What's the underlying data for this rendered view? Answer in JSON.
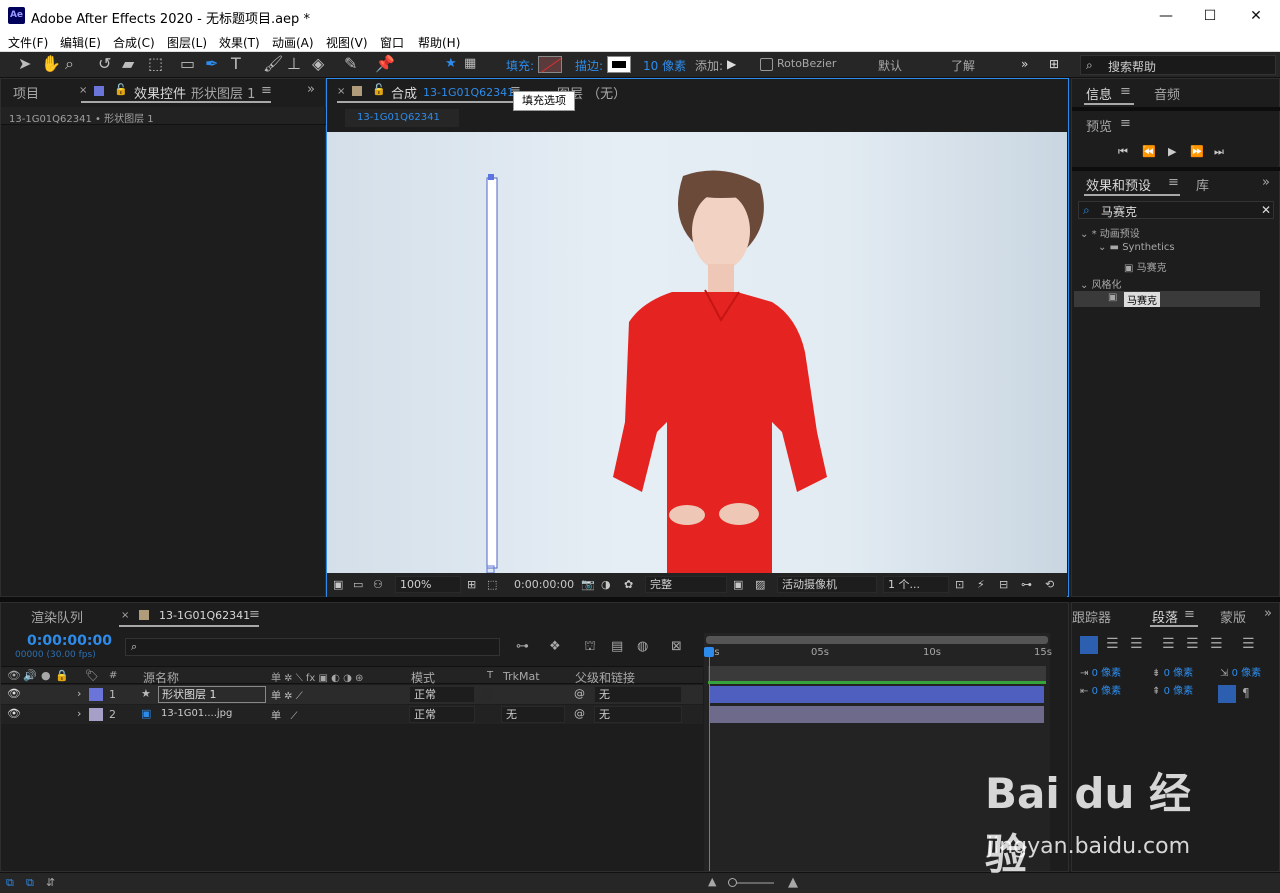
{
  "app": {
    "title": "Adobe After Effects 2020 - 无标题项目.aep *",
    "logo": "Ae"
  },
  "window_controls": {
    "minimize": "—",
    "maximize": "☐",
    "close": "✕"
  },
  "menu": [
    "文件(F)",
    "编辑(E)",
    "合成(C)",
    "图层(L)",
    "效果(T)",
    "动画(A)",
    "视图(V)",
    "窗口",
    "帮助(H)"
  ],
  "toolbar": {
    "fill_label": "填充:",
    "stroke_label": "描边:",
    "stroke_width": "10 像素",
    "add_label": "添加:",
    "roto_label": "RotoBezier",
    "default_label": "默认",
    "learn_label": "了解",
    "search_placeholder": "搜索帮助",
    "tooltip": "填充选项"
  },
  "left_panel": {
    "tab_project": "项目",
    "tab_effects_prefix": "效果控件",
    "tab_effects_layer": "形状图层 1",
    "breadcrumb": "13-1G01Q62341 • 形状图层 1"
  },
  "comp_panel": {
    "tab_label": "合成",
    "comp_name": "13-1G01Q62341",
    "layer_tab": "图层 （无）",
    "sub_tab": "13-1G01Q62341"
  },
  "viewer_bar": {
    "zoom": "100%",
    "timecode": "0:00:00:00",
    "quality": "完整",
    "camera": "活动摄像机",
    "views": "1 个..."
  },
  "right_panel": {
    "tab_info": "信息",
    "tab_audio": "音频",
    "tab_preview": "预览",
    "tab_effects": "效果和预设",
    "tab_library": "库",
    "search_value": "马赛克",
    "tree": [
      {
        "label": "* 动画预设",
        "level": 0
      },
      {
        "label": "Synthetics",
        "level": 1
      },
      {
        "label": "马赛克",
        "level": 2
      },
      {
        "label": "风格化",
        "level": 0
      },
      {
        "label": "马赛克",
        "level": 1,
        "selected": true
      }
    ],
    "tracker_tab": "跟踪器",
    "paragraph_tab": "段落",
    "mask_tab": "蒙版",
    "para_values": [
      "0 像素",
      "0 像素",
      "0 像素",
      "0 像素",
      "0 像素"
    ]
  },
  "timeline": {
    "render_tab": "渲染队列",
    "comp_tab": "13-1G01Q62341",
    "timecode": "0:00:00:00",
    "fps": "00000 (30.00 fps)",
    "search_placeholder": "",
    "columns": {
      "num": "#",
      "name": "源名称",
      "mode": "模式",
      "t": "T",
      "trkmat": "TrkMat",
      "parent": "父级和链接"
    },
    "layers": [
      {
        "num": "1",
        "name": "形状图层 1",
        "mode": "正常",
        "trkmat": "",
        "parent": "无",
        "color": "#6b74d9",
        "bar": "#4f5fc0"
      },
      {
        "num": "2",
        "name": "13-1G01....jpg",
        "mode": "正常",
        "trkmat": "无",
        "parent": "无",
        "color": "#a6a0c8",
        "bar": "#6e6a8c"
      }
    ],
    "ruler": [
      "0s",
      "05s",
      "10s",
      "15s"
    ]
  },
  "watermark": {
    "brand": "Bai du 经验",
    "url": "jingyan.baidu.com"
  }
}
